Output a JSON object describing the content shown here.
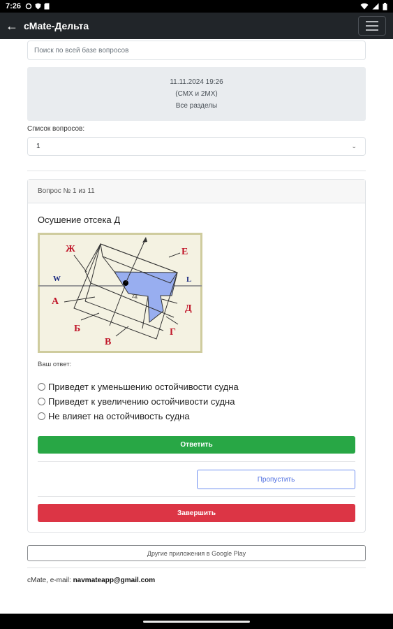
{
  "status_bar": {
    "time": "7:26"
  },
  "app_bar": {
    "title": "cMate-Дельта"
  },
  "search": {
    "placeholder": "Поиск по всей базе вопросов"
  },
  "info": {
    "date": "11.11.2024 19:26",
    "category": "(СМХ и 2МХ)",
    "sections": "Все разделы"
  },
  "question_list": {
    "label": "Список вопросов:",
    "selected": "1"
  },
  "card": {
    "header": "Вопрос № 1 из 11",
    "question_title": "Осушение отсека Д",
    "diagram_labels": {
      "zh": "Ж",
      "e": "Е",
      "w": "W",
      "l": "L",
      "a": "А",
      "d": "Д",
      "b": "Б",
      "v": "В",
      "g": "Г",
      "zg": "Zg"
    },
    "answer_label": "Ваш ответ:",
    "options": [
      "Приведет к уменьшению остойчивости судна",
      "Приведет к увеличению остойчивости судна",
      "Не влияет на остойчивость судна"
    ],
    "answer_button": "Ответить",
    "skip_button": "Пропустить",
    "finish_button": "Завершить"
  },
  "google_play_button": "Другие приложения в Google Play",
  "footer": {
    "prefix": "cMate, e-mail: ",
    "email": "navmateapp@gmail.com"
  },
  "colors": {
    "answer": "#28a745",
    "finish": "#dc3545",
    "appbar": "#212529",
    "compartment_fill": "#98aef0"
  }
}
